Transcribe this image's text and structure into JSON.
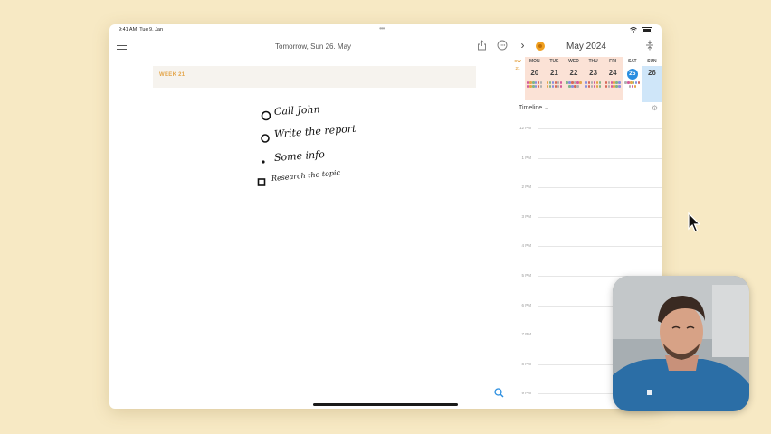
{
  "status_bar": {
    "time": "9:41 AM",
    "date": "Tue 9. Jan"
  },
  "toolbar": {
    "date_title": "Tomorrow, Sun 26. May",
    "month_title": "May 2024"
  },
  "week_banner": {
    "label": "WEEK 21"
  },
  "notes": {
    "lines": [
      "Call John",
      "Write the report",
      "Some info",
      "Research the topic"
    ],
    "bullet_types": [
      "circle",
      "circle",
      "dot",
      "square"
    ]
  },
  "mini_calendar": {
    "cw_label": "CW",
    "cw_number": "21",
    "days": [
      {
        "name": "MON",
        "num": "20"
      },
      {
        "name": "TUE",
        "num": "21"
      },
      {
        "name": "WED",
        "num": "22"
      },
      {
        "name": "THU",
        "num": "23"
      },
      {
        "name": "FRI",
        "num": "24"
      },
      {
        "name": "SAT",
        "num": "25"
      },
      {
        "name": "SUN",
        "num": "26"
      }
    ],
    "today_index": 5,
    "selected_index": 6
  },
  "timeline": {
    "label": "Timeline",
    "hours": [
      "12 PM",
      "1 PM",
      "2 PM",
      "3 PM",
      "4 PM",
      "5 PM",
      "6 PM",
      "7 PM",
      "8 PM",
      "9 PM"
    ]
  },
  "colors": {
    "accent_orange": "#e4a64b",
    "today_blue": "#2a8ee0",
    "range_pink": "#fbe2d6",
    "selected_blue": "#cfe6f9",
    "background": "#f7e9c4"
  },
  "icons": [
    "menu-icon",
    "share-icon",
    "more-icon",
    "chevron-right-icon",
    "expand-icon",
    "gear-icon",
    "search-icon",
    "wifi-icon",
    "battery-icon",
    "mouse-cursor-icon"
  ]
}
